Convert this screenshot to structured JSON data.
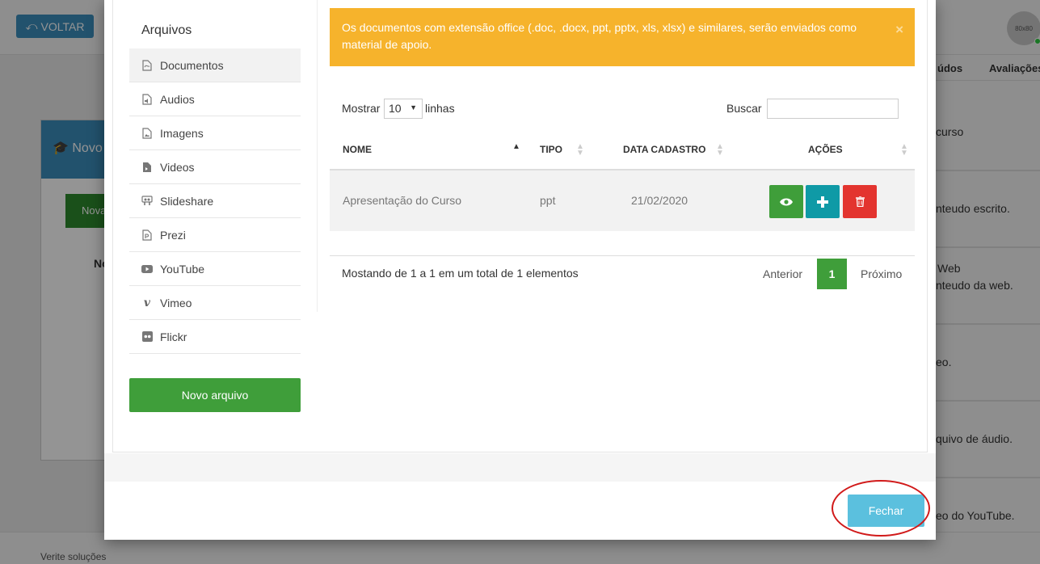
{
  "background": {
    "back_button": "VOLTAR",
    "avatar": "80x80",
    "panel_title": "Novo",
    "green_button": "Nova",
    "bold_text": "No",
    "footer_text": "Verite soluções",
    "tabs": [
      "údos",
      "Avaliações"
    ],
    "right_items": [
      [
        "curso"
      ],
      [
        "nteudo escrito."
      ],
      [
        "Web",
        "nteudo da web."
      ],
      [
        "eo."
      ],
      [
        "quivo de áudio."
      ],
      [
        "eo do YouTube."
      ]
    ]
  },
  "sidebar": {
    "title": "Arquivos",
    "items": [
      {
        "label": "Documentos",
        "icon": "pdf-file-icon"
      },
      {
        "label": "Audios",
        "icon": "audio-file-icon"
      },
      {
        "label": "Imagens",
        "icon": "image-file-icon"
      },
      {
        "label": "Videos",
        "icon": "video-file-icon"
      },
      {
        "label": "Slideshare",
        "icon": "slideshare-icon"
      },
      {
        "label": "Prezi",
        "icon": "prezi-file-icon"
      },
      {
        "label": "YouTube",
        "icon": "youtube-icon"
      },
      {
        "label": "Vimeo",
        "icon": "vimeo-icon"
      },
      {
        "label": "Flickr",
        "icon": "flickr-icon"
      }
    ],
    "new_button": "Novo arquivo"
  },
  "alert": {
    "text": "Os documentos com extensão office (.doc, .docx, ppt, pptx, xls, xlsx) e similares, serão enviados como material de apoio.",
    "close": "×"
  },
  "table_controls": {
    "show_label": "Mostrar",
    "show_value": "10",
    "rows_label": "linhas",
    "search_label": "Buscar",
    "search_value": ""
  },
  "table": {
    "columns": [
      "NOME",
      "TIPO",
      "DATA CADASTRO",
      "AÇÕES"
    ],
    "rows": [
      {
        "name": "Apresentação do Curso",
        "type": "ppt",
        "date": "21/02/2020"
      }
    ]
  },
  "footer": {
    "info": "Mostando de 1 a 1 em um total de 1 elementos",
    "previous": "Anterior",
    "page": "1",
    "next": "Próximo"
  },
  "modal": {
    "close_button": "Fechar"
  },
  "colors": {
    "green": "#3f9e3a",
    "teal": "#0f9aa6",
    "red": "#e3342f",
    "warning": "#f6b32c",
    "info": "#5bc0de",
    "highlight_ring": "#d11a1a"
  }
}
